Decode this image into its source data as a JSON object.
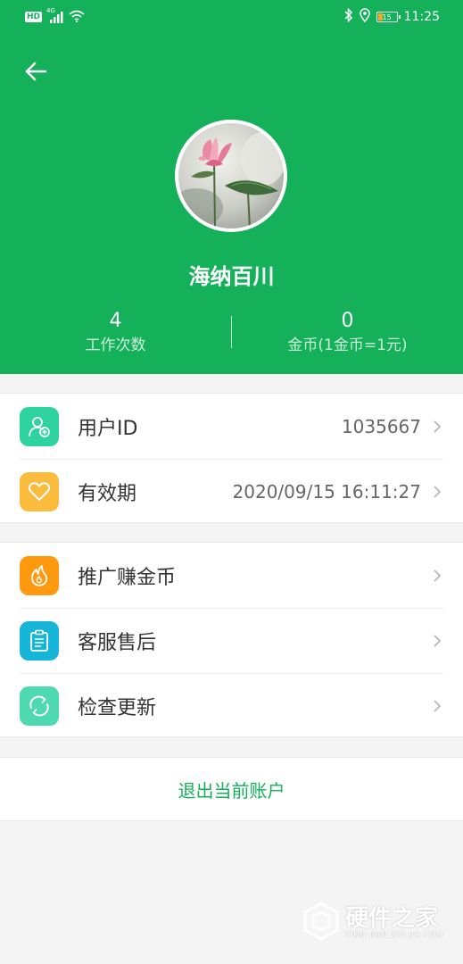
{
  "status_bar": {
    "hd": "HD",
    "network": "4G",
    "battery": "15",
    "time": "11:25"
  },
  "header": {
    "username": "海纳百川",
    "stats": [
      {
        "value": "4",
        "label": "工作次数"
      },
      {
        "value": "0",
        "label": "金币(1金币=1元)"
      }
    ]
  },
  "account_section": {
    "items": [
      {
        "label": "用户ID",
        "value": "1035667",
        "icon": "user-add-icon",
        "color": "#2ed3a0"
      },
      {
        "label": "有效期",
        "value": "2020/09/15 16:11:27",
        "icon": "heart-icon",
        "color": "#fbbb3c"
      }
    ]
  },
  "service_section": {
    "items": [
      {
        "label": "推广赚金币",
        "icon": "fire-icon",
        "color": "#ff9910"
      },
      {
        "label": "客服售后",
        "icon": "clipboard-icon",
        "color": "#17b6d8"
      },
      {
        "label": "检查更新",
        "icon": "refresh-icon",
        "color": "#4fd9b0"
      }
    ]
  },
  "logout_label": "退出当前账户",
  "colors": {
    "brand_green": "#14b15a",
    "background": "#f4f4f4"
  },
  "watermark": {
    "title": "硬件之家",
    "subtitle": "YING JIAN ZHI JIA.COM"
  }
}
